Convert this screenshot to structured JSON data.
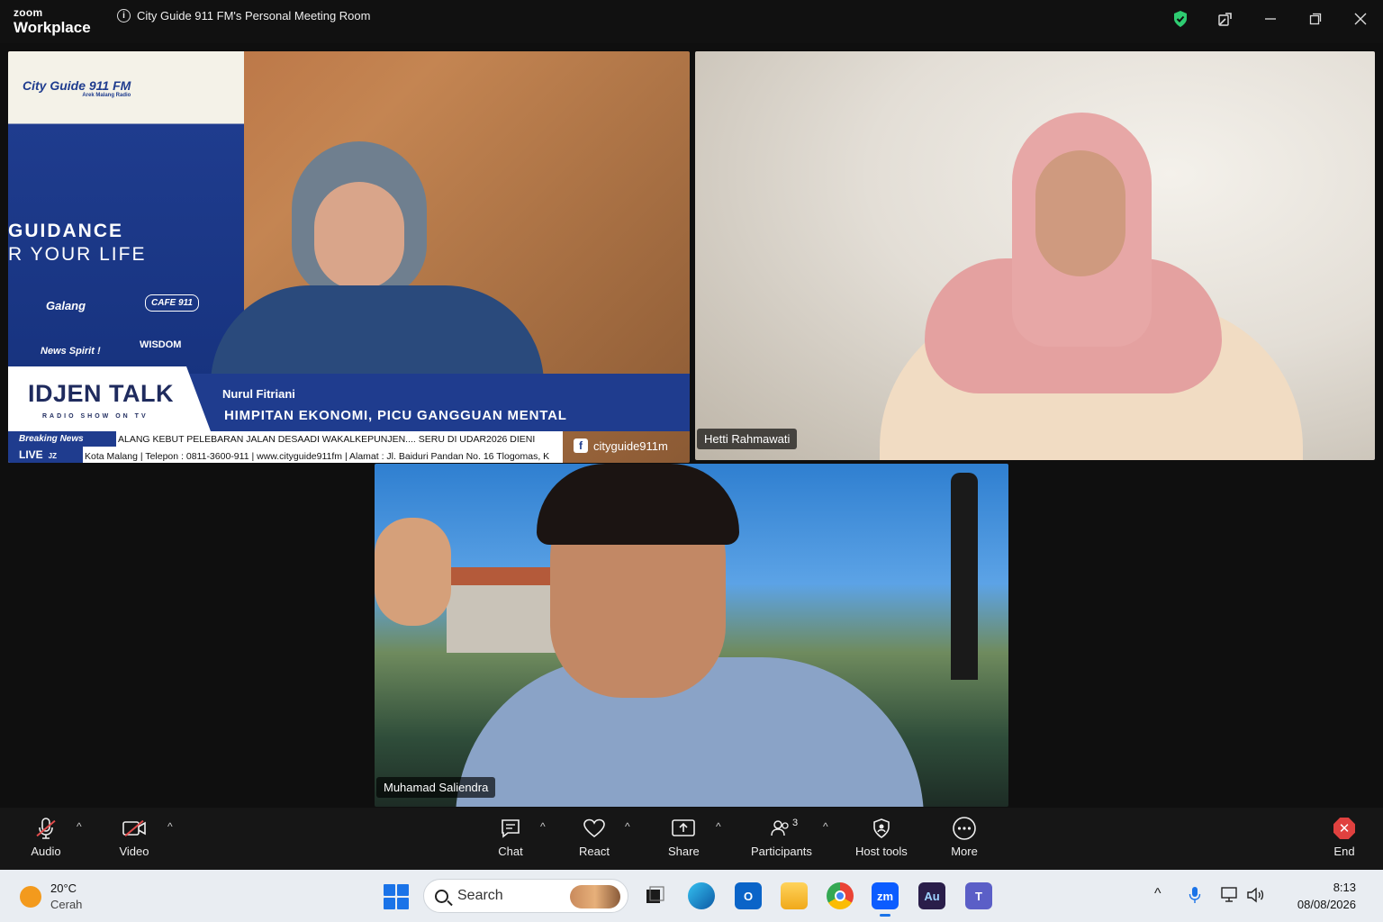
{
  "window": {
    "brand_small": "zoom",
    "brand_big": "Workplace",
    "meeting_title": "City Guide 911 FM's Personal Meeting Room",
    "controls": [
      "shield-check",
      "pop-out",
      "minimize",
      "maximize",
      "close"
    ]
  },
  "tiles": [
    {
      "participant": "Nurul Fitriani",
      "overlay": {
        "station_logo": "City Guide 911 FM",
        "station_tagline": "Arek Malang Radio",
        "slogan_line1": "GUIDANCE",
        "slogan_line2": "R YOUR LIFE",
        "chips": [
          "Galang",
          "CAFE 911",
          "News Spirit !",
          "WISDOM"
        ],
        "show_title": "IDJEN TALK",
        "show_subtitle": "RADIO SHOW ON TV",
        "headline": "HIMPITAN EKONOMI, PICU GANGGUAN MENTAL",
        "ticker_label": "Breaking News",
        "live_label": "LIVE",
        "live_suffix": "JZ",
        "ticker_line1": "ALANG KEBUT PELEBARAN JALAN DESAADI WAKALKEPUNJEN....          SERU DI UDAR2026 DIENI",
        "ticker_line2": "Kota Malang | Telepon : 0811-3600-911 | www.cityguide911fm | Alamat : Jl. Baiduri Pandan No. 16 Tlogomas, K",
        "social_handle": "cityguide911m"
      }
    },
    {
      "participant": "Hetti Rahmawati"
    },
    {
      "participant": "Muhamad Saliendra"
    }
  ],
  "toolbar": {
    "audio": "Audio",
    "video": "Video",
    "chat": "Chat",
    "react": "React",
    "share": "Share",
    "participants": "Participants",
    "participants_count": "3",
    "host_tools": "Host tools",
    "more": "More",
    "end": "End"
  },
  "taskbar": {
    "temperature": "20°C",
    "condition": "Cerah",
    "search_placeholder": "Search",
    "apps": [
      "task-view",
      "edge",
      "outlook",
      "file-explorer",
      "chrome",
      "zoom",
      "audition",
      "teams"
    ],
    "zoom_label": "zm",
    "audition_label": "Au",
    "teams_label": "T",
    "time": "8:13",
    "date": "08/08/2026"
  },
  "colors": {
    "accent_blue": "#1f3c8e",
    "end_red": "#e0413f",
    "mute_red": "#e24c4c",
    "online_green": "#2ecc71"
  }
}
